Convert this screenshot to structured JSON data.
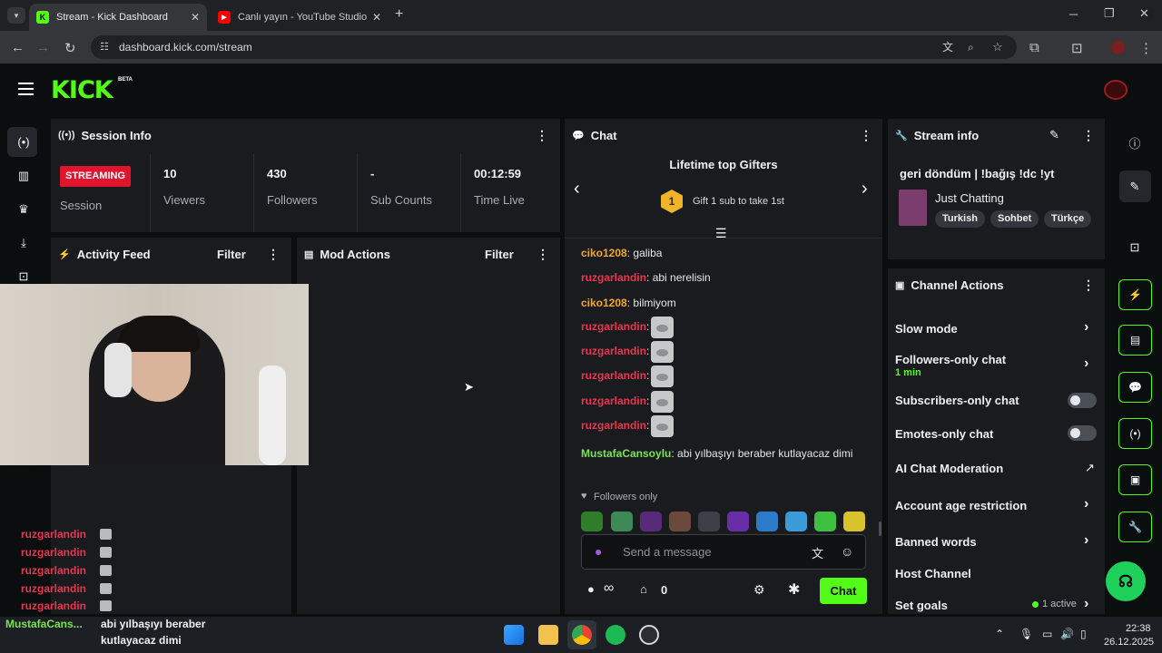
{
  "browser": {
    "tabs": [
      {
        "label": "Stream - Kick Dashboard",
        "active": true
      },
      {
        "label": "Canlı yayın - YouTube Studio",
        "active": false
      }
    ],
    "url": "dashboard.kick.com/stream"
  },
  "brand": {
    "logo": "KICK",
    "beta": "BETA",
    "accent": "#53fc18"
  },
  "session_info": {
    "title": "Session Info",
    "status_badge": "STREAMING",
    "session_label": "Session",
    "stats": [
      {
        "value": "10",
        "label": "Viewers"
      },
      {
        "value": "430",
        "label": "Followers"
      },
      {
        "value": "-",
        "label": "Sub Counts"
      },
      {
        "value": "00:12:59",
        "label": "Time Live"
      }
    ]
  },
  "activity_feed": {
    "title": "Activity Feed",
    "filter": "Filter"
  },
  "mod_actions": {
    "title": "Mod Actions",
    "filter": "Filter"
  },
  "chat": {
    "title": "Chat",
    "gifters_title": "Lifetime top Gifters",
    "gifter_rank": "1",
    "gifter_text": "Gift 1 sub to take 1st",
    "messages": [
      {
        "user": "ciko1208",
        "text": "galiba",
        "color": "orange"
      },
      {
        "user": "ruzgarlandin",
        "text": "abi nerelisin",
        "color": "red"
      },
      {
        "user": "ciko1208",
        "text": "bilmiyom",
        "color": "orange"
      },
      {
        "user": "ruzgarlandin",
        "text": "",
        "emote": true,
        "color": "red"
      },
      {
        "user": "ruzgarlandin",
        "text": "",
        "emote": true,
        "color": "red"
      },
      {
        "user": "ruzgarlandin",
        "text": "",
        "emote": true,
        "color": "red"
      },
      {
        "user": "ruzgarlandin",
        "text": "",
        "emote": true,
        "color": "red"
      },
      {
        "user": "ruzgarlandin",
        "text": "",
        "emote": true,
        "color": "red"
      },
      {
        "user": "MustafaCansoylu",
        "text": "abi yılbaşıyı beraber kutlayacaz dimi",
        "color": "green"
      }
    ],
    "mode_label": "Followers only",
    "input_placeholder": "Send a message",
    "infinity_count": "∞",
    "points": "0",
    "send_button": "Chat"
  },
  "stream_info": {
    "title": "Stream info",
    "stream_title": "geri döndüm | !bağış !dc !yt",
    "category": "Just Chatting",
    "tags": [
      "Turkish",
      "Sohbet",
      "Türkçe"
    ]
  },
  "channel_actions": {
    "title": "Channel Actions",
    "slow_mode": "Slow mode",
    "followers_only": "Followers-only chat",
    "followers_only_value": "1 min",
    "subscribers_only": "Subscribers-only chat",
    "emotes_only": "Emotes-only chat",
    "ai_moderation": "AI Chat Moderation",
    "account_age": "Account age restriction",
    "banned_words": "Banned words",
    "host_channel": "Host Channel",
    "set_goals": "Set goals",
    "goals_active": "1 active"
  },
  "overlay": {
    "chat_names": [
      "ruzgarlandin",
      "ruzgarlandin",
      "ruzgarlandin",
      "ruzgarlandin",
      "ruzgarlandin"
    ],
    "caption_user": "MustafaCans...",
    "caption_line1": "abi yılbaşıyı beraber",
    "caption_line2": "kutlayacaz dimi"
  },
  "taskbar": {
    "time": "22:38",
    "date": "26.12.2025"
  },
  "colors": {
    "streaming_red": "#e1142e",
    "orange_user": "#f5a623",
    "red_user": "#e8364f",
    "green_user": "#7be354"
  }
}
